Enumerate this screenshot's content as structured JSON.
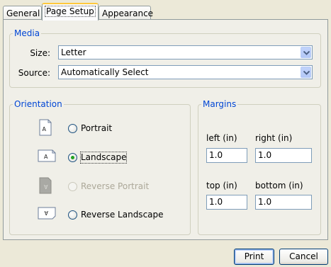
{
  "tabs": [
    {
      "label": "General",
      "active": false
    },
    {
      "label": "Page Setup",
      "active": true
    },
    {
      "label": "Appearance",
      "active": false
    }
  ],
  "media": {
    "legend": "Media",
    "size_label": "Size:",
    "size_value": "Letter",
    "source_label": "Source:",
    "source_value": "Automatically Select"
  },
  "orientation": {
    "legend": "Orientation",
    "options": [
      {
        "label": "Portrait",
        "checked": false,
        "disabled": false,
        "icon": "portrait-page-icon"
      },
      {
        "label": "Landscape",
        "checked": true,
        "disabled": false,
        "icon": "landscape-page-icon"
      },
      {
        "label": "Reverse Portrait",
        "checked": false,
        "disabled": true,
        "icon": "reverse-portrait-page-icon"
      },
      {
        "label": "Reverse Landscape",
        "checked": false,
        "disabled": false,
        "icon": "reverse-landscape-page-icon"
      }
    ]
  },
  "margins": {
    "legend": "Margins",
    "left_label": "left (in)",
    "left_value": "1.0",
    "right_label": "right (in)",
    "right_value": "1.0",
    "top_label": "top (in)",
    "top_value": "1.0",
    "bottom_label": "bottom (in)",
    "bottom_value": "1.0"
  },
  "buttons": {
    "print_label": "Print",
    "cancel_label": "Cancel"
  },
  "colors": {
    "legend_text": "#0046d5",
    "active_tab_highlight": "#ffc83c",
    "selected_radio": "#21a121"
  }
}
